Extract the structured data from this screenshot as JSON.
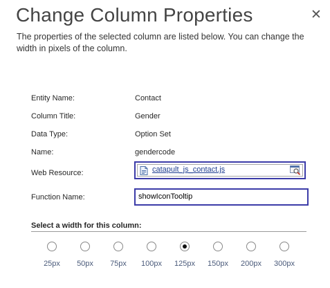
{
  "dialog": {
    "title": "Change Column Properties",
    "close_glyph": "✕",
    "description": "The properties of the selected column are listed below. You can change the width in pixels of the column."
  },
  "fields": [
    {
      "label": "Entity Name:",
      "value": "Contact"
    },
    {
      "label": "Column Title:",
      "value": "Gender"
    },
    {
      "label": "Data Type:",
      "value": "Option Set"
    },
    {
      "label": "Name:",
      "value": "gendercode"
    }
  ],
  "web_resource": {
    "label": "Web Resource:",
    "value": "catapult_js_contact.js",
    "icon": "document-icon",
    "lookup_icon": "lookup-icon"
  },
  "function_name": {
    "label": "Function Name:",
    "value": "showIconTooltip"
  },
  "width_section": {
    "title": "Select a width for this column:",
    "options": [
      "25px",
      "50px",
      "75px",
      "100px",
      "125px",
      "150px",
      "200px",
      "300px"
    ],
    "selected": "125px"
  },
  "colors": {
    "focus_border": "#3b3ba8",
    "link": "#1f3f91"
  }
}
